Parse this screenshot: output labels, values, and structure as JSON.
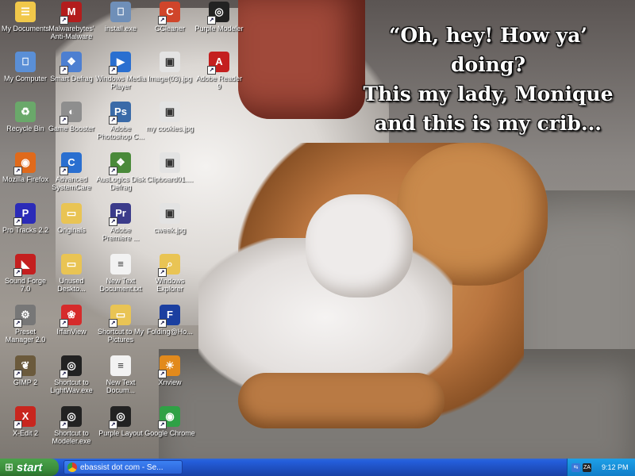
{
  "wallpaper": {
    "caption": [
      "“Oh, hey! How ya’ doing?",
      "This my lady, Monique",
      "and this is my crib..."
    ]
  },
  "desktop_icons": [
    {
      "label": "My Documents",
      "icon": "folder-documents-icon",
      "color": "#f1c84a",
      "glyph": "☰",
      "shortcut": false
    },
    {
      "label": "My Computer",
      "icon": "computer-icon",
      "color": "#5a8fd6",
      "glyph": "⎕",
      "shortcut": false
    },
    {
      "label": "Recycle Bin",
      "icon": "recycle-bin-icon",
      "color": "#6aa86a",
      "glyph": "♻",
      "shortcut": false
    },
    {
      "label": "Mozilla Firefox",
      "icon": "firefox-icon",
      "color": "#e06a1b",
      "glyph": "◉",
      "shortcut": true
    },
    {
      "label": "Pro Tracks 2.2",
      "icon": "pro-tracks-icon",
      "color": "#2b2bb8",
      "glyph": "P",
      "shortcut": true
    },
    {
      "label": "Sound Forge 7.0",
      "icon": "sound-forge-icon",
      "color": "#c41f1f",
      "glyph": "◣",
      "shortcut": true
    },
    {
      "label": "Preset Manager 2.0",
      "icon": "preset-manager-icon",
      "color": "#777777",
      "glyph": "⚙",
      "shortcut": true
    },
    {
      "label": "GIMP 2",
      "icon": "gimp-icon",
      "color": "#6b5a3c",
      "glyph": "❦",
      "shortcut": true
    },
    {
      "label": "X-Edit 2",
      "icon": "x-edit-icon",
      "color": "#c8261e",
      "glyph": "X",
      "shortcut": true
    },
    {
      "label": "Malwarebytes' Anti-Malware",
      "icon": "malwarebytes-icon",
      "color": "#b31d1d",
      "glyph": "M",
      "shortcut": true
    },
    {
      "label": "Smart Defrag",
      "icon": "smart-defrag-icon",
      "color": "#4d7fd1",
      "glyph": "❖",
      "shortcut": true
    },
    {
      "label": "Game Booster",
      "icon": "game-booster-icon",
      "color": "#8e8e8e",
      "glyph": "◐",
      "shortcut": true
    },
    {
      "label": "Advanced SystemCare",
      "icon": "advanced-systemcare-icon",
      "color": "#2a6fd0",
      "glyph": "C",
      "shortcut": true
    },
    {
      "label": "Originals",
      "icon": "folder-icon",
      "color": "#e9c454",
      "glyph": "▭",
      "shortcut": false
    },
    {
      "label": "Unused Deskto...",
      "icon": "folder-icon",
      "color": "#e9c454",
      "glyph": "▭",
      "shortcut": false
    },
    {
      "label": "IrfanView",
      "icon": "irfanview-icon",
      "color": "#d62b2b",
      "glyph": "❀",
      "shortcut": true
    },
    {
      "label": "Shortcut to LightWav.exe",
      "icon": "lightwave-icon",
      "color": "#222222",
      "glyph": "◎",
      "shortcut": true
    },
    {
      "label": "Shortcut to Modeler.exe",
      "icon": "modeler-icon",
      "color": "#222222",
      "glyph": "◎",
      "shortcut": true
    },
    {
      "label": "install.exe",
      "icon": "install-exe-icon",
      "color": "#6f8fb8",
      "glyph": "⎕",
      "shortcut": false
    },
    {
      "label": "Windows Media Player",
      "icon": "windows-media-player-icon",
      "color": "#2a6fd0",
      "glyph": "▶",
      "shortcut": true
    },
    {
      "label": "Adobe Photoshop C...",
      "icon": "photoshop-icon",
      "color": "#3a6aa8",
      "glyph": "Ps",
      "shortcut": true
    },
    {
      "label": "AusLogics Disk Defrag",
      "icon": "auslogics-icon",
      "color": "#4a8a3a",
      "glyph": "❖",
      "shortcut": true
    },
    {
      "label": "Adobe Premiere ...",
      "icon": "premiere-icon",
      "color": "#3b3b8a",
      "glyph": "Pr",
      "shortcut": true
    },
    {
      "label": "New Text Document.txt",
      "icon": "text-document-icon",
      "color": "#f2f2f2",
      "glyph": "≡",
      "shortcut": false
    },
    {
      "label": "Shortcut to My Pictures",
      "icon": "my-pictures-icon",
      "color": "#e9c454",
      "glyph": "▭",
      "shortcut": true
    },
    {
      "label": "New Text Docum...",
      "icon": "text-document-icon",
      "color": "#f2f2f2",
      "glyph": "≡",
      "shortcut": false
    },
    {
      "label": "Purple Layout",
      "icon": "purple-layout-icon",
      "color": "#222222",
      "glyph": "◎",
      "shortcut": true
    },
    {
      "label": "CCleaner",
      "icon": "ccleaner-icon",
      "color": "#d0452a",
      "glyph": "C",
      "shortcut": true
    },
    {
      "label": "Image(03).jpg",
      "icon": "image-file-icon",
      "color": "#e3e3e3",
      "glyph": "▣",
      "shortcut": false
    },
    {
      "label": "my cookies.jpg",
      "icon": "image-file-icon",
      "color": "#e3e3e3",
      "glyph": "▣",
      "shortcut": false
    },
    {
      "label": "Clipboard01....",
      "icon": "image-file-icon",
      "color": "#e3e3e3",
      "glyph": "▣",
      "shortcut": false
    },
    {
      "label": "cweek.jpg",
      "icon": "image-file-icon",
      "color": "#e3e3e3",
      "glyph": "▣",
      "shortcut": false
    },
    {
      "label": "Windows Explorer",
      "icon": "windows-explorer-icon",
      "color": "#e9c454",
      "glyph": "⌕",
      "shortcut": true
    },
    {
      "label": "Folding@Ho...",
      "icon": "folding-at-home-icon",
      "color": "#1b3fa0",
      "glyph": "F",
      "shortcut": true
    },
    {
      "label": "Xnview",
      "icon": "xnview-icon",
      "color": "#e28a1c",
      "glyph": "☀",
      "shortcut": true
    },
    {
      "label": "Google Chrome",
      "icon": "google-chrome-icon",
      "color": "#2fa145",
      "glyph": "◉",
      "shortcut": true
    },
    {
      "label": "Purple Modeler",
      "icon": "purple-modeler-icon",
      "color": "#222222",
      "glyph": "◎",
      "shortcut": true
    },
    {
      "label": "Adobe Reader 9",
      "icon": "adobe-reader-icon",
      "color": "#c41f1f",
      "glyph": "A",
      "shortcut": true
    }
  ],
  "taskbar": {
    "start_label": "start",
    "start_icon": "windows-flag-icon",
    "tasks": [
      {
        "label": "ebassist dot com - Se...",
        "icon": "google-chrome-icon"
      }
    ],
    "tray_icons": [
      "network-icon",
      "zonealarm-icon"
    ],
    "clock": "9:12 PM"
  }
}
